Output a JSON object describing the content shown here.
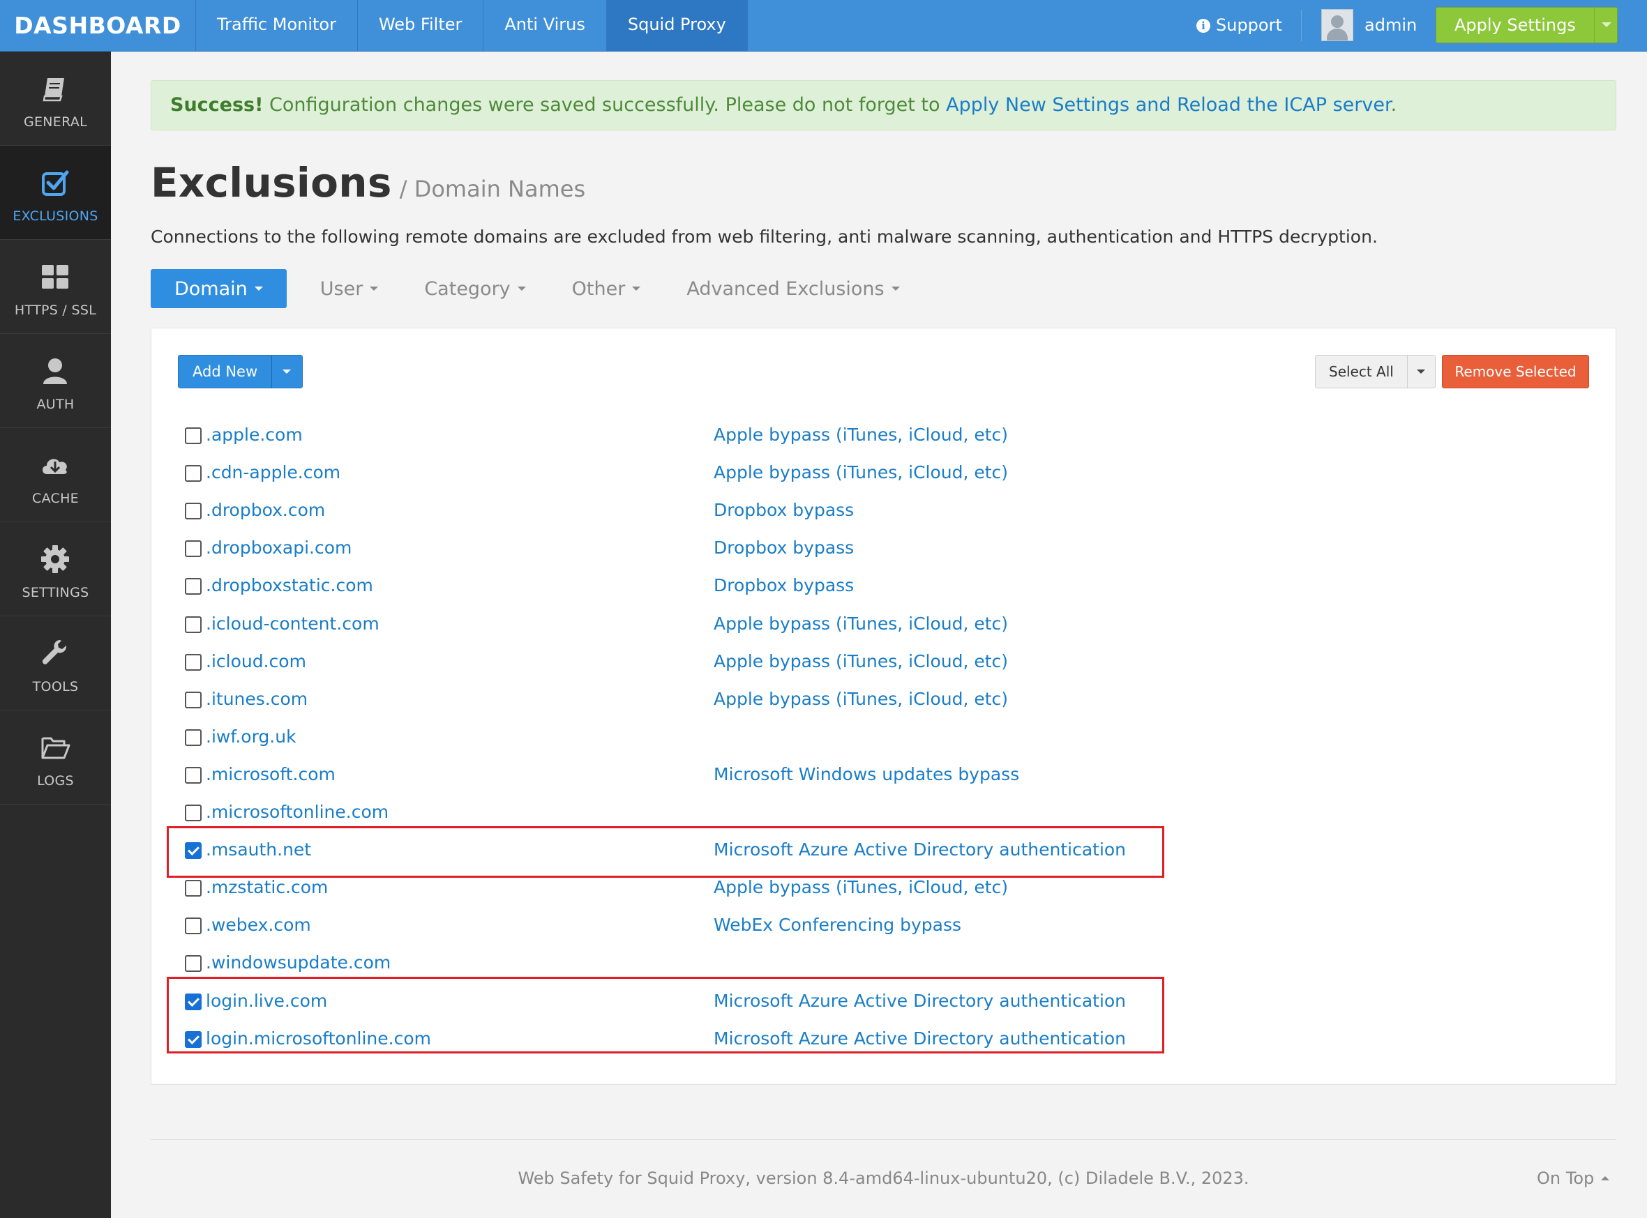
{
  "header": {
    "brand": "DASHBOARD",
    "nav": [
      "Traffic Monitor",
      "Web Filter",
      "Anti Virus",
      "Squid Proxy"
    ],
    "active_nav": "Squid Proxy",
    "support": "Support",
    "user": "admin",
    "apply": "Apply Settings"
  },
  "sidebar": {
    "items": [
      {
        "label": "GENERAL",
        "icon": "book-icon"
      },
      {
        "label": "EXCLUSIONS",
        "icon": "checkbox-icon"
      },
      {
        "label": "HTTPS / SSL",
        "icon": "grid-icon"
      },
      {
        "label": "AUTH",
        "icon": "user-icon"
      },
      {
        "label": "CACHE",
        "icon": "cloud-download-icon"
      },
      {
        "label": "SETTINGS",
        "icon": "gear-icon"
      },
      {
        "label": "TOOLS",
        "icon": "wrench-icon"
      },
      {
        "label": "LOGS",
        "icon": "folder-open-icon"
      }
    ],
    "active": "EXCLUSIONS"
  },
  "alert": {
    "strong": "Success!",
    "text": " Configuration changes were saved successfully. Please do not forget to ",
    "link": "Apply New Settings and Reload the ICAP server",
    "end": "."
  },
  "page": {
    "title": "Exclusions",
    "subtitle": "/ Domain Names",
    "description": "Connections to the following remote domains are excluded from web filtering, anti malware scanning, authentication and HTTPS decryption."
  },
  "tabs": [
    "Domain",
    "User",
    "Category",
    "Other",
    "Advanced Exclusions"
  ],
  "toolbar": {
    "add_new": "Add New",
    "select_all": "Select All",
    "remove_selected": "Remove Selected"
  },
  "domains": [
    {
      "domain": ".apple.com",
      "comment": "Apple bypass (iTunes, iCloud, etc)",
      "checked": false
    },
    {
      "domain": ".cdn-apple.com",
      "comment": "Apple bypass (iTunes, iCloud, etc)",
      "checked": false
    },
    {
      "domain": ".dropbox.com",
      "comment": "Dropbox bypass",
      "checked": false
    },
    {
      "domain": ".dropboxapi.com",
      "comment": "Dropbox bypass",
      "checked": false
    },
    {
      "domain": ".dropboxstatic.com",
      "comment": "Dropbox bypass",
      "checked": false
    },
    {
      "domain": ".icloud-content.com",
      "comment": "Apple bypass (iTunes, iCloud, etc)",
      "checked": false
    },
    {
      "domain": ".icloud.com",
      "comment": "Apple bypass (iTunes, iCloud, etc)",
      "checked": false
    },
    {
      "domain": ".itunes.com",
      "comment": "Apple bypass (iTunes, iCloud, etc)",
      "checked": false
    },
    {
      "domain": ".iwf.org.uk",
      "comment": "",
      "checked": false
    },
    {
      "domain": ".microsoft.com",
      "comment": "Microsoft Windows updates bypass",
      "checked": false
    },
    {
      "domain": ".microsoftonline.com",
      "comment": "",
      "checked": false
    },
    {
      "domain": ".msauth.net",
      "comment": "Microsoft Azure Active Directory authentication",
      "checked": true
    },
    {
      "domain": ".mzstatic.com",
      "comment": "Apple bypass (iTunes, iCloud, etc)",
      "checked": false
    },
    {
      "domain": ".webex.com",
      "comment": "WebEx Conferencing bypass",
      "checked": false
    },
    {
      "domain": ".windowsupdate.com",
      "comment": "",
      "checked": false
    },
    {
      "domain": "login.live.com",
      "comment": "Microsoft Azure Active Directory authentication",
      "checked": true
    },
    {
      "domain": "login.microsoftonline.com",
      "comment": "Microsoft Azure Active Directory authentication",
      "checked": true
    }
  ],
  "footer": {
    "text": "Web Safety for Squid Proxy, version 8.4-amd64-linux-ubuntu20, (c) Diladele B.V., 2023.",
    "on_top": "On Top"
  },
  "colors": {
    "header": "#3f8fd9",
    "sidebar": "#2b2b2b",
    "link": "#1a7dc7",
    "apply": "#8cc83a",
    "remove": "#e85f3a",
    "highlight": "#e01e26"
  }
}
